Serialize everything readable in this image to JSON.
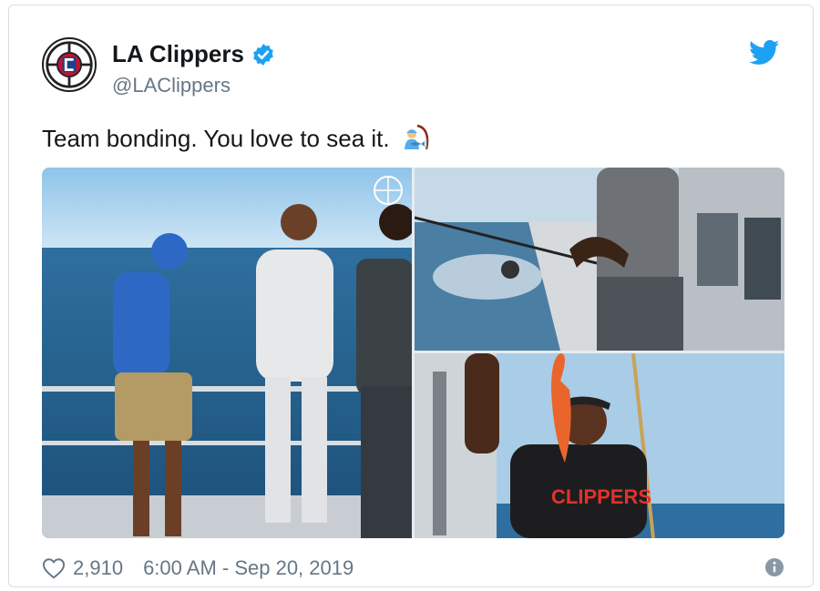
{
  "author": {
    "display_name": "LA Clippers",
    "handle": "@LAClippers",
    "verified": true,
    "avatar_icon": "la-clippers-logo-icon"
  },
  "tweet": {
    "text": "Team bonding. You love to sea it.",
    "emoji_icon": "person-fishing-emoji-icon"
  },
  "media": {
    "photos": [
      {
        "name": "photo-players-on-boat",
        "description_icon": "photo"
      },
      {
        "name": "photo-fishing-rod",
        "description_icon": "photo"
      },
      {
        "name": "photo-player-holding-fish",
        "description_icon": "photo"
      }
    ]
  },
  "footer": {
    "likes": "2,910",
    "timestamp": "6:00 AM - Sep 20, 2019"
  },
  "colors": {
    "twitter_blue": "#1da1f2",
    "verified_blue": "#1da1f2",
    "muted_text": "#657786",
    "clippers_red": "#c8102e",
    "clippers_blue": "#1d428a"
  }
}
